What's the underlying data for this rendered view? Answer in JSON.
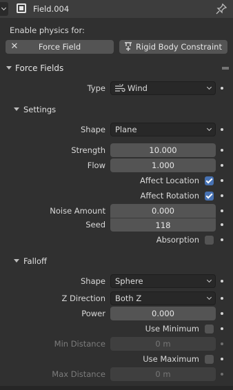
{
  "header": {
    "title": "Field.004"
  },
  "enable_label": "Enable physics for:",
  "buttons": {
    "force_field": "Force Field",
    "rigid_body_constraint": "Rigid Body Constraint"
  },
  "panels": {
    "force_fields": "Force Fields",
    "settings": "Settings",
    "falloff": "Falloff"
  },
  "force_fields": {
    "type_label": "Type",
    "type_value": "Wind"
  },
  "settings": {
    "shape_label": "Shape",
    "shape_value": "Plane",
    "strength_label": "Strength",
    "strength_value": "10.000",
    "flow_label": "Flow",
    "flow_value": "1.000",
    "affect_location_label": "Affect Location",
    "affect_location_checked": true,
    "affect_rotation_label": "Affect Rotation",
    "affect_rotation_checked": true,
    "noise_amount_label": "Noise Amount",
    "noise_amount_value": "0.000",
    "seed_label": "Seed",
    "seed_value": "118",
    "absorption_label": "Absorption",
    "absorption_checked": false
  },
  "falloff": {
    "shape_label": "Shape",
    "shape_value": "Sphere",
    "z_direction_label": "Z Direction",
    "z_direction_value": "Both Z",
    "power_label": "Power",
    "power_value": "0.000",
    "use_minimum_label": "Use Minimum",
    "use_minimum_checked": false,
    "min_distance_label": "Min Distance",
    "min_distance_value": "0 m",
    "use_maximum_label": "Use Maximum",
    "use_maximum_checked": false,
    "max_distance_label": "Max Distance",
    "max_distance_value": "0 m"
  },
  "colors": {
    "accent": "#4772b3",
    "background": "#303030",
    "field": "#545454"
  }
}
